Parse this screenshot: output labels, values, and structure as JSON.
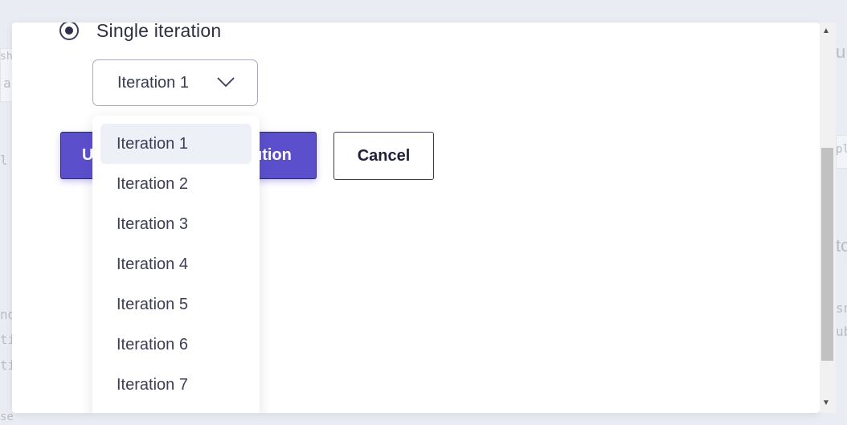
{
  "background": {
    "fragments": [
      "sh",
      "a",
      "l :",
      "nd",
      "ti",
      "ti",
      "se",
      "u",
      "ple",
      "to",
      "sn",
      "ub"
    ]
  },
  "modal": {
    "radio_label": "Single iteration",
    "select": {
      "value": "Iteration 1",
      "icon": "chevron-down-icon"
    },
    "primary_button": {
      "label_start": "U",
      "label_end": "ution"
    },
    "cancel_button": "Cancel",
    "dropdown": {
      "options": [
        "Iteration 1",
        "Iteration 2",
        "Iteration 3",
        "Iteration 4",
        "Iteration 5",
        "Iteration 6",
        "Iteration 7"
      ],
      "selected": "Iteration 1"
    }
  },
  "colors": {
    "primary": "#5b4fcc",
    "text": "#2f2f45",
    "border": "#a9a9c6"
  }
}
